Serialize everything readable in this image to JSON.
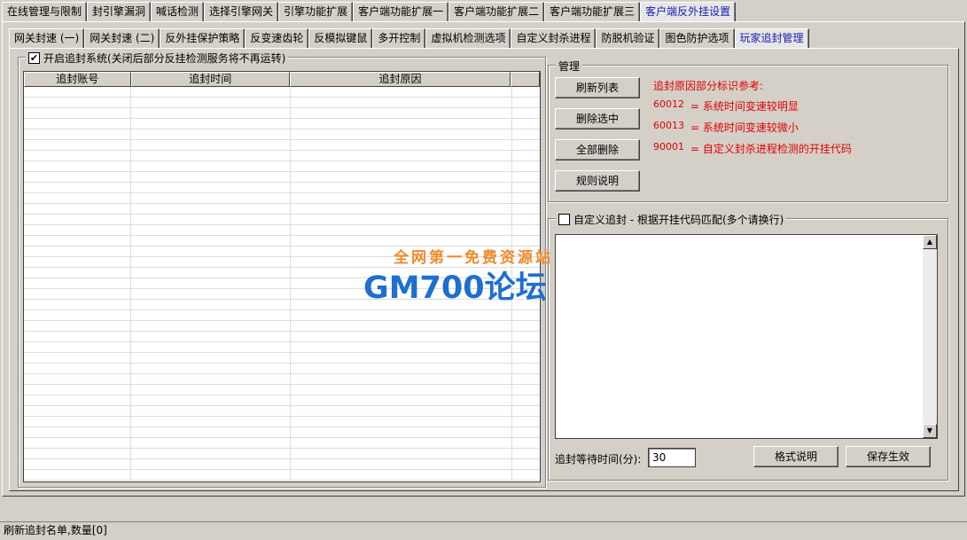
{
  "top_tabs": [
    {
      "label": "在线管理与限制"
    },
    {
      "label": "封引擎漏洞"
    },
    {
      "label": "喊话检测"
    },
    {
      "label": "选择引擎网关"
    },
    {
      "label": "引擎功能扩展"
    },
    {
      "label": "客户端功能扩展一"
    },
    {
      "label": "客户端功能扩展二"
    },
    {
      "label": "客户端功能扩展三"
    },
    {
      "label": "客户端反外挂设置"
    }
  ],
  "sub_tabs": [
    {
      "label": "网关封速 (一)"
    },
    {
      "label": "网关封速 (二)"
    },
    {
      "label": "反外挂保护策略"
    },
    {
      "label": "反变速齿轮"
    },
    {
      "label": "反模拟键鼠"
    },
    {
      "label": "多开控制"
    },
    {
      "label": "虚拟机检测选项"
    },
    {
      "label": "自定义封杀进程"
    },
    {
      "label": "防脱机验证"
    },
    {
      "label": "图色防护选项"
    },
    {
      "label": "玩家追封管理"
    }
  ],
  "pursuit_group": {
    "checkbox_checked": "✔",
    "title": "开启追封系统(关闭后部分反挂检测服务将不再运转)"
  },
  "list": {
    "columns": [
      "追封账号",
      "追封时间",
      "追封原因",
      ""
    ]
  },
  "manage": {
    "title": "管理",
    "refresh": "刷新列表",
    "delete_selected": "删除选中",
    "delete_all": "全部删除",
    "rules": "规则说明",
    "ref_title": "追封原因部分标识参考:",
    "refs": [
      {
        "code": "60012",
        "text": "= 系统时间变速较明显"
      },
      {
        "code": "60013",
        "text": "= 系统时间变速较微小"
      },
      {
        "code": "90001",
        "text": "= 自定义封杀进程检测的开挂代码"
      }
    ]
  },
  "custom_group": {
    "title": "自定义追封 - 根据开挂代码匹配(多个请换行)",
    "textarea_value": "",
    "wait_label": "追封等待时间(分):",
    "wait_value": "30",
    "format_button": "格式说明",
    "save_button": "保存生效"
  },
  "watermark": {
    "line1": "全网第一免费资源站",
    "line2": "GM700论坛"
  },
  "status_bar": "刷新追封名单,数量[0]"
}
